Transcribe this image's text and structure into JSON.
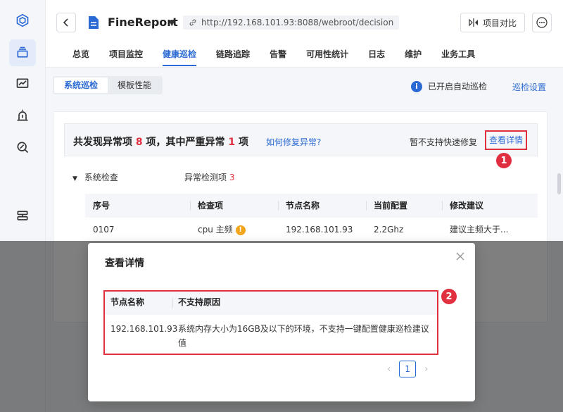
{
  "header": {
    "app_name": "FineReport",
    "url": "http://192.168.101.93:8088/webroot/decision",
    "compare_label": "项目对比"
  },
  "nav_tabs": [
    "总览",
    "项目监控",
    "健康巡检",
    "链路追踪",
    "告警",
    "可用性统计",
    "日志",
    "维护",
    "业务工具"
  ],
  "subtabs": {
    "system_patrol": "系统巡检",
    "template_perf": "模板性能"
  },
  "auto_patrol": {
    "status": "已开启自动巡检",
    "settings_link": "巡检设置"
  },
  "summary": {
    "prefix": "共发现异常项",
    "count": "8",
    "middle": "项，其中严重异常",
    "severe": "1",
    "suffix": "项",
    "fix_link": "如何修复异常?",
    "no_quick_fix": "暂不支持快速修复",
    "detail_link": "查看详情"
  },
  "section": {
    "title": "系统检查",
    "abnormal_label": "异常检测项",
    "abnormal_count": "3"
  },
  "table": {
    "headers": [
      "序号",
      "检查项",
      "节点名称",
      "当前配置",
      "修改建议"
    ],
    "rows": [
      [
        "0107",
        "cpu 主频",
        "192.168.101.93",
        "2.2Ghz",
        "建议主频大于..."
      ]
    ]
  },
  "modal": {
    "title": "查看详情",
    "headers": [
      "节点名称",
      "不支持原因"
    ],
    "rows": [
      [
        "192.168.101.93",
        "系统内存大小为16GB及以下的环境，不支持一键配置健康巡检建议值"
      ]
    ],
    "page": "1"
  },
  "markers": [
    "1",
    "2"
  ],
  "colors": {
    "accent": "#2b6ad4",
    "danger": "#e0303f",
    "warning": "#f2a51a"
  }
}
